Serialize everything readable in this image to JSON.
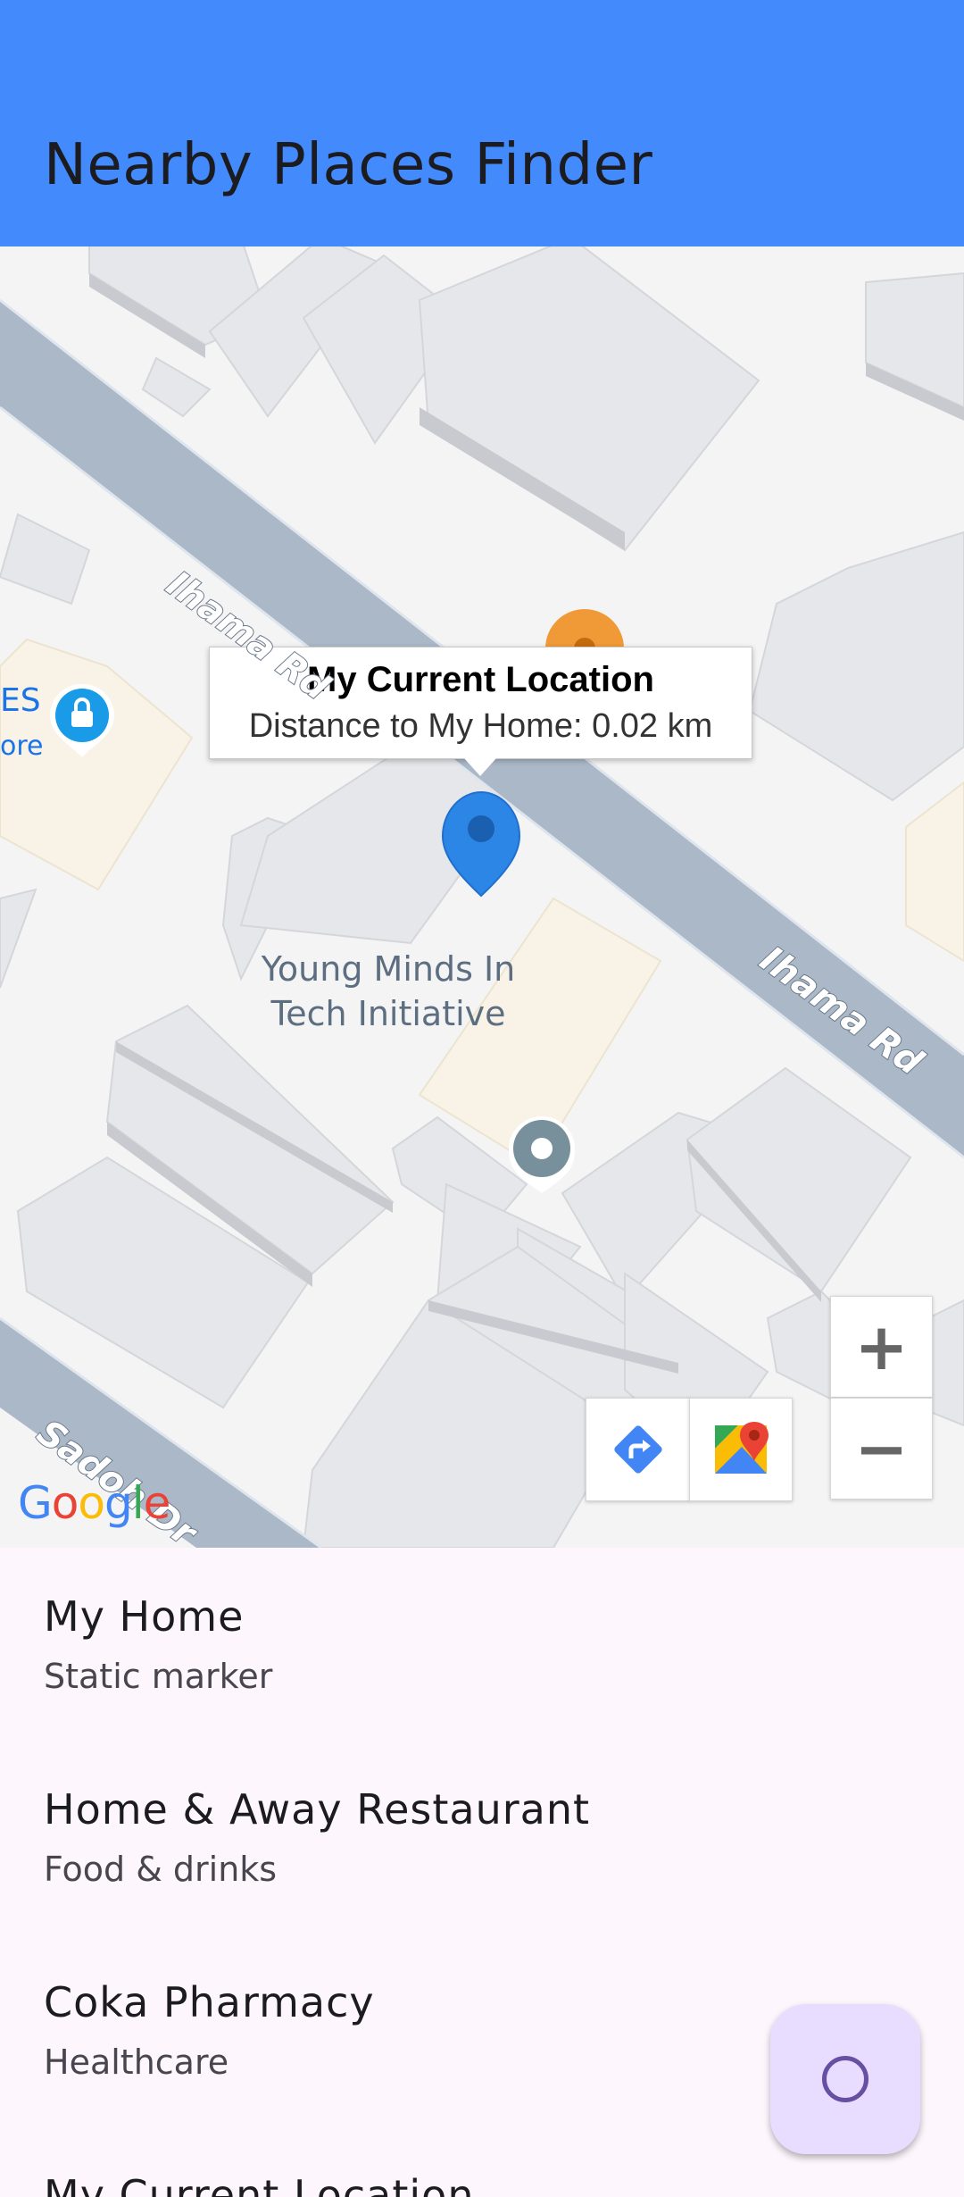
{
  "app": {
    "title": "Nearby Places Finder"
  },
  "map": {
    "info_window": {
      "title": "My Current Location",
      "snippet": "Distance to My Home: 0.02 km"
    },
    "poi_label": "Young Minds In Tech Initiative",
    "poi_label_line1": "Young Minds In",
    "poi_label_line2": "Tech Initiative",
    "road_labels": [
      "Ihama Rd",
      "Ihama Rd",
      "Sadoh Dr"
    ],
    "partial_label_top": "ES",
    "partial_label_bottom": "ore",
    "attribution": "Google",
    "controls": {
      "zoom_in": "+",
      "zoom_out": "−",
      "directions_icon": "directions-icon",
      "maps_icon": "google-maps-icon"
    },
    "colors": {
      "appbar": "#438bfc",
      "road": "#aab8c8",
      "marker": "#2b86e6"
    }
  },
  "places": [
    {
      "title": "My Home",
      "subtitle": "Static marker"
    },
    {
      "title": "Home & Away Restaurant",
      "subtitle": "Food & drinks"
    },
    {
      "title": "Coka Pharmacy",
      "subtitle": "Healthcare"
    },
    {
      "title": "My Current Location",
      "subtitle": ""
    }
  ],
  "fab": {
    "icon": "loading-spinner-icon"
  }
}
